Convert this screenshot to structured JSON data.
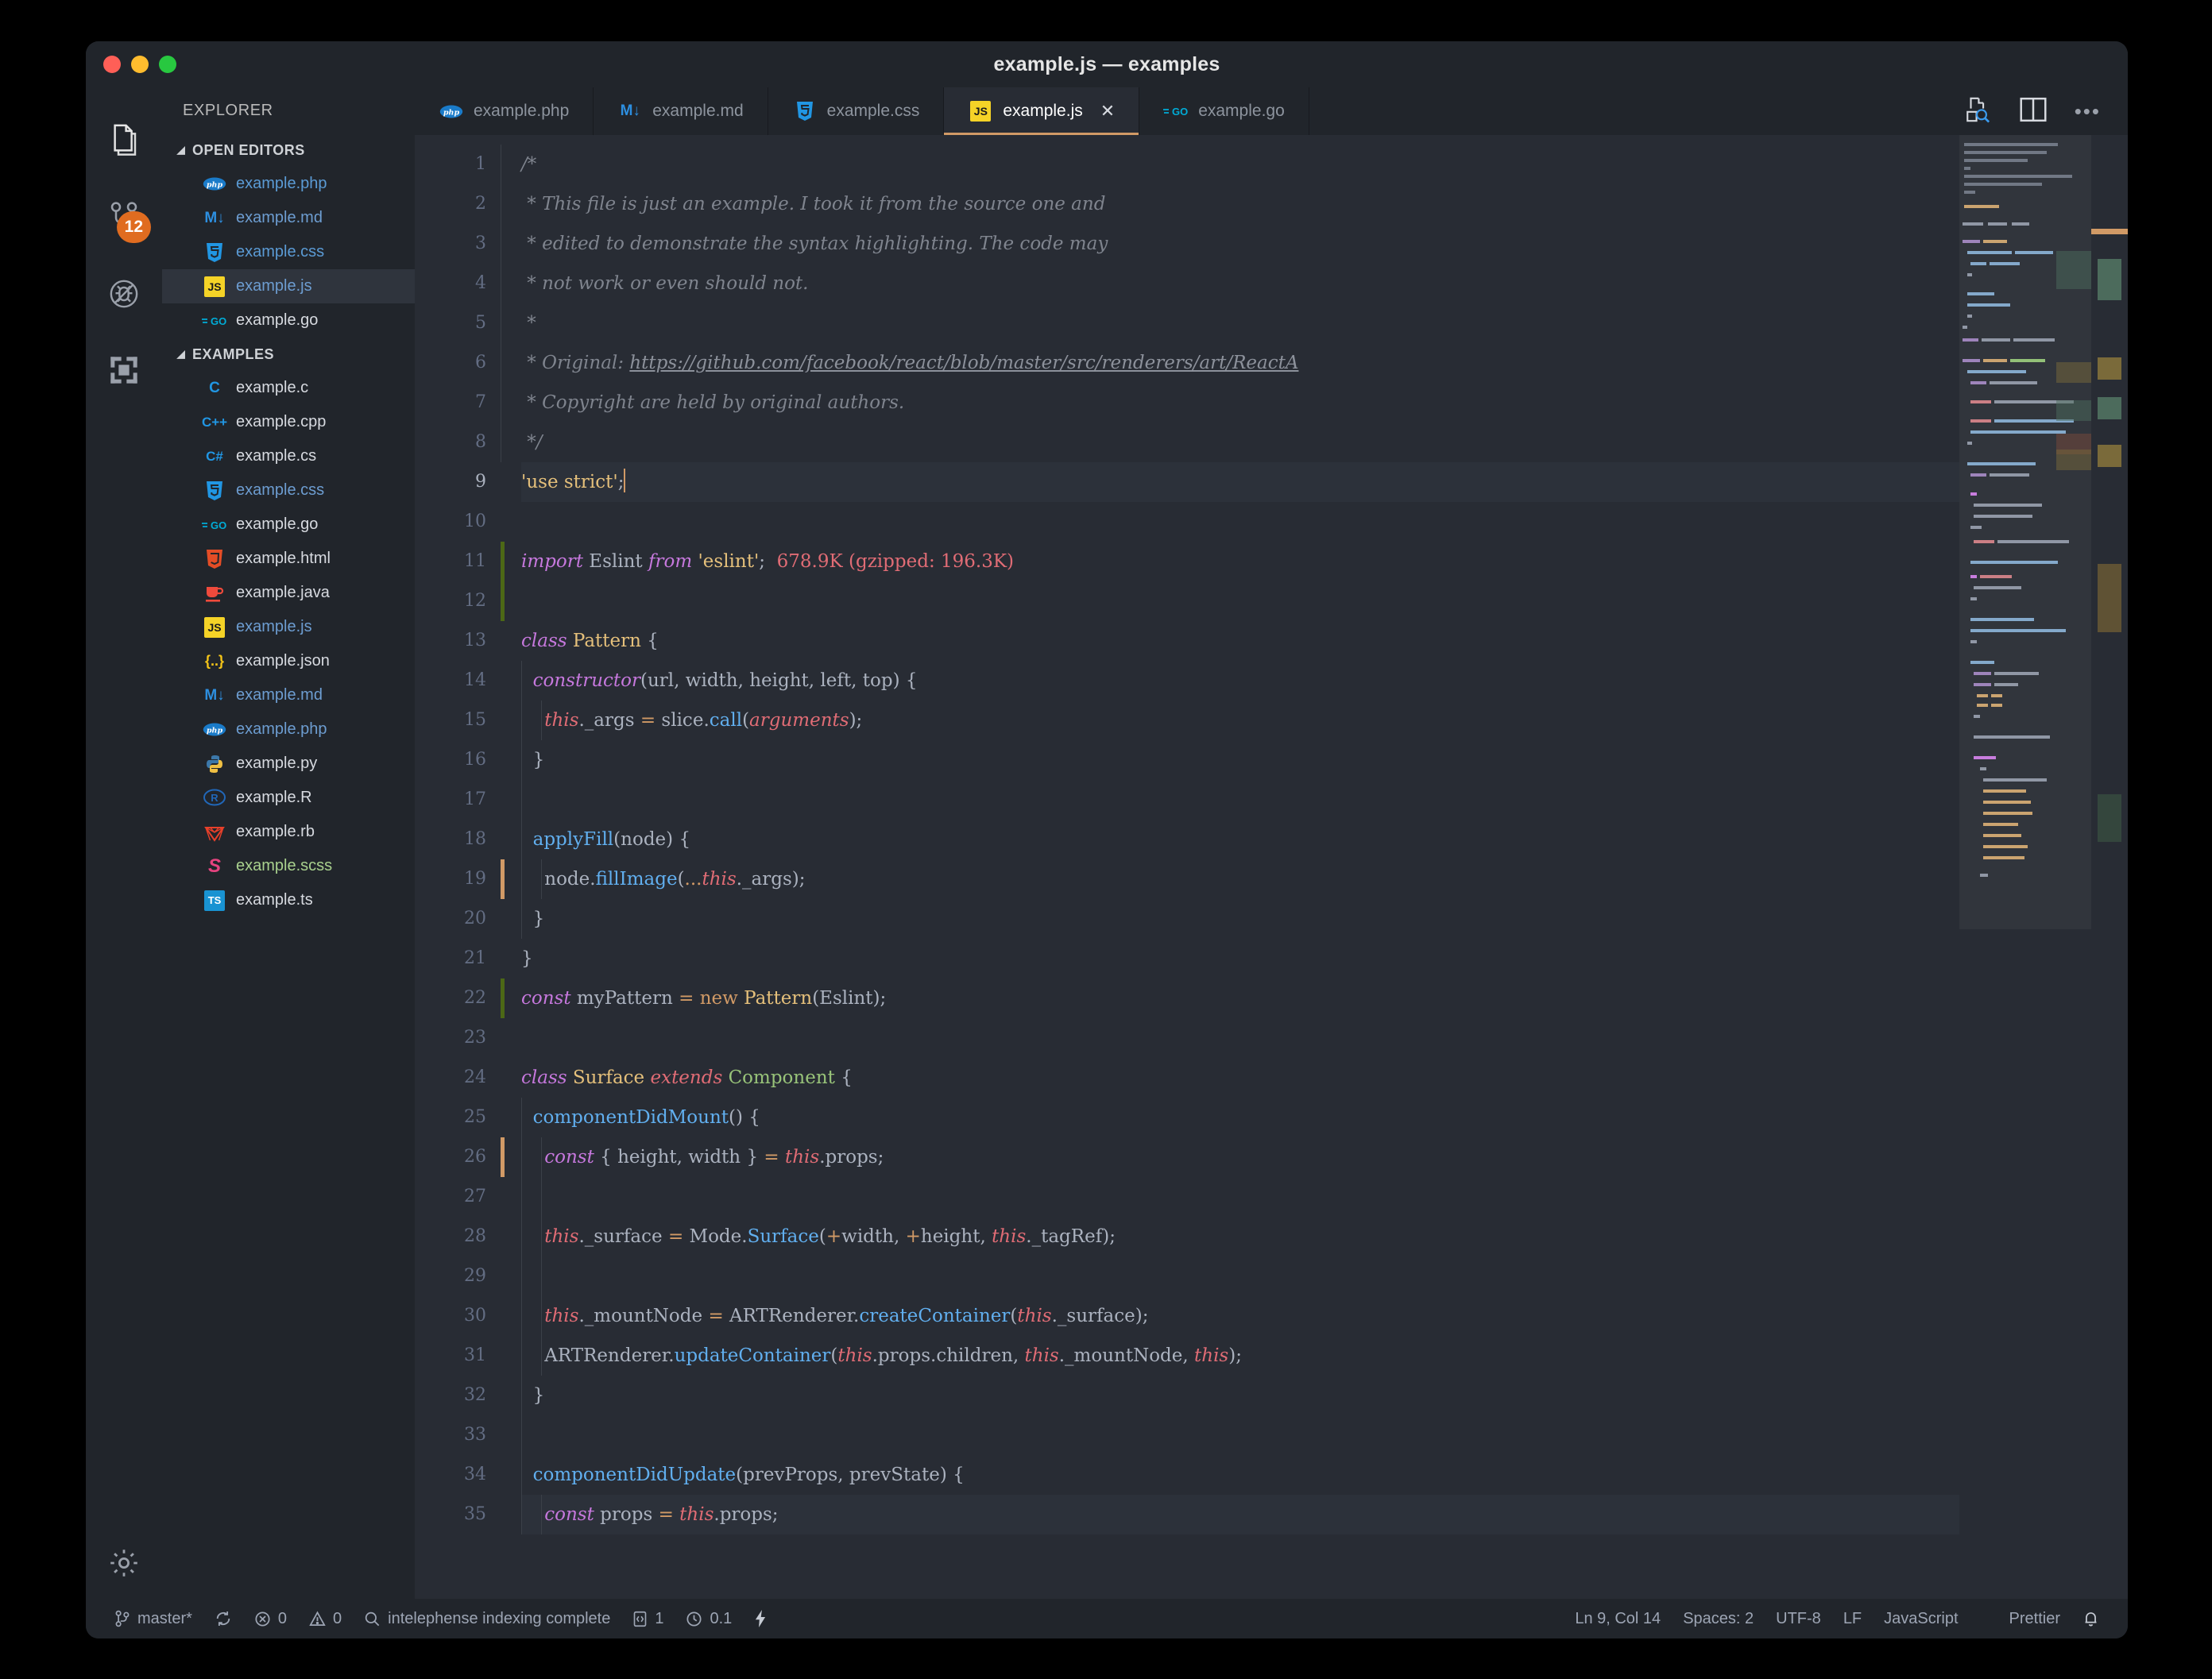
{
  "window": {
    "title": "example.js — examples",
    "traffic_lights": [
      "close",
      "minimize",
      "maximize"
    ]
  },
  "activitybar": {
    "items": [
      {
        "name": "explorer",
        "icon": "files-icon",
        "active": true
      },
      {
        "name": "source-control",
        "icon": "source-control-icon",
        "badge": "12"
      },
      {
        "name": "run-and-debug",
        "icon": "debug-disabled-icon"
      },
      {
        "name": "extensions",
        "icon": "extensions-icon"
      }
    ],
    "settings": {
      "name": "manage",
      "icon": "gear-icon"
    }
  },
  "sidebar": {
    "title": "EXPLORER",
    "sections": [
      {
        "label": "OPEN EDITORS",
        "expanded": true,
        "items": [
          {
            "name": "example.php",
            "icon": "php-icon",
            "color": "#5089c0",
            "selected": false
          },
          {
            "name": "example.md",
            "icon": "markdown-icon",
            "color": "#6d9dd1",
            "selected": false
          },
          {
            "name": "example.css",
            "icon": "css-icon",
            "color": "#5b9bd5",
            "selected": false
          },
          {
            "name": "example.js",
            "icon": "javascript-icon",
            "color": "#6d9dd1",
            "selected": true
          },
          {
            "name": "example.go",
            "icon": "go-icon",
            "color": "#d7dae0",
            "selected": false
          }
        ]
      },
      {
        "label": "EXAMPLES",
        "expanded": true,
        "items": [
          {
            "name": "example.c",
            "icon": "c-icon",
            "color": "#d7dae0"
          },
          {
            "name": "example.cpp",
            "icon": "cpp-icon",
            "color": "#d7dae0"
          },
          {
            "name": "example.cs",
            "icon": "csharp-icon",
            "color": "#d7dae0"
          },
          {
            "name": "example.css",
            "icon": "css-icon",
            "color": "#6d9dd1"
          },
          {
            "name": "example.go",
            "icon": "go-icon",
            "color": "#d7dae0"
          },
          {
            "name": "example.html",
            "icon": "html-icon",
            "color": "#d7dae0"
          },
          {
            "name": "example.java",
            "icon": "java-icon",
            "color": "#d7dae0"
          },
          {
            "name": "example.js",
            "icon": "javascript-icon",
            "color": "#6d9dd1"
          },
          {
            "name": "example.json",
            "icon": "json-icon",
            "color": "#d7dae0"
          },
          {
            "name": "example.md",
            "icon": "markdown-icon",
            "color": "#6d9dd1"
          },
          {
            "name": "example.php",
            "icon": "php-icon",
            "color": "#6d9dd1"
          },
          {
            "name": "example.py",
            "icon": "python-icon",
            "color": "#d7dae0"
          },
          {
            "name": "example.R",
            "icon": "r-icon",
            "color": "#d7dae0"
          },
          {
            "name": "example.rb",
            "icon": "ruby-icon",
            "color": "#d7dae0"
          },
          {
            "name": "example.scss",
            "icon": "sass-icon",
            "color": "#a9d18e"
          },
          {
            "name": "example.ts",
            "icon": "typescript-icon",
            "color": "#d7dae0"
          }
        ]
      }
    ]
  },
  "tabs": {
    "items": [
      {
        "label": "example.php",
        "icon": "php-icon",
        "active": false,
        "closable": false
      },
      {
        "label": "example.md",
        "icon": "markdown-icon",
        "active": false,
        "closable": false
      },
      {
        "label": "example.css",
        "icon": "css-icon",
        "active": false,
        "closable": false
      },
      {
        "label": "example.js",
        "icon": "javascript-icon",
        "active": true,
        "closable": true,
        "close_glyph": "✕"
      },
      {
        "label": "example.go",
        "icon": "go-icon",
        "active": false,
        "closable": false
      }
    ],
    "actions": [
      {
        "name": "open-changes",
        "icon": "open-changes-icon"
      },
      {
        "name": "split-editor",
        "icon": "split-editor-icon"
      },
      {
        "name": "more-actions",
        "icon": "ellipsis-icon",
        "glyph": "•••"
      }
    ]
  },
  "editor": {
    "language": "JavaScript",
    "active_line": 9,
    "lines": [
      {
        "n": 1,
        "indent": 0
      },
      {
        "n": 2,
        "indent": 0
      },
      {
        "n": 3,
        "indent": 0
      },
      {
        "n": 4,
        "indent": 0
      },
      {
        "n": 5,
        "indent": 0
      },
      {
        "n": 6,
        "indent": 0
      },
      {
        "n": 7,
        "indent": 0
      },
      {
        "n": 8,
        "indent": 0
      },
      {
        "n": 9,
        "indent": 0
      },
      {
        "n": 10,
        "indent": 0
      },
      {
        "n": 11,
        "indent": 0
      },
      {
        "n": 12,
        "indent": 0
      },
      {
        "n": 13,
        "indent": 0
      },
      {
        "n": 14,
        "indent": 0
      },
      {
        "n": 15,
        "indent": 0
      },
      {
        "n": 16,
        "indent": 0
      },
      {
        "n": 17,
        "indent": 0
      },
      {
        "n": 18,
        "indent": 0
      },
      {
        "n": 19,
        "indent": 0
      },
      {
        "n": 20,
        "indent": 0
      },
      {
        "n": 21,
        "indent": 0
      },
      {
        "n": 22,
        "indent": 0
      },
      {
        "n": 23,
        "indent": 0
      },
      {
        "n": 24,
        "indent": 0
      },
      {
        "n": 25,
        "indent": 0
      },
      {
        "n": 26,
        "indent": 0
      },
      {
        "n": 27,
        "indent": 0
      },
      {
        "n": 28,
        "indent": 0
      },
      {
        "n": 29,
        "indent": 0
      },
      {
        "n": 30,
        "indent": 0
      },
      {
        "n": 31,
        "indent": 0
      },
      {
        "n": 32,
        "indent": 0
      },
      {
        "n": 33,
        "indent": 0
      },
      {
        "n": 34,
        "indent": 0
      },
      {
        "n": 35,
        "indent": 0
      }
    ],
    "code_text": [
      "/*",
      " * This file is just an example. I took it from the source one and",
      " * edited to demonstrate the syntax highlighting. The code may",
      " * not work or even should not.",
      " *",
      " * Original: https://github.com/facebook/react/blob/master/src/renderers/art/ReactA",
      " * Copyright are held by original authors.",
      " */",
      "'use strict';",
      "",
      "import Eslint from 'eslint';  678.9K (gzipped: 196.3K)",
      "",
      "class Pattern {",
      "  constructor(url, width, height, left, top) {",
      "    this._args = slice.call(arguments);",
      "  }",
      "",
      "  applyFill(node) {",
      "    node.fillImage(...this._args);",
      "  }",
      "}",
      "const myPattern = new Pattern(Eslint);",
      "",
      "class Surface extends Component {",
      "  componentDidMount() {",
      "    const { height, width } = this.props;",
      "",
      "    this._surface = Mode.Surface(+width, +height, this._tagRef);",
      "",
      "    this._mountNode = ARTRenderer.createContainer(this._surface);",
      "    ARTRenderer.updateContainer(this.props.children, this._mountNode, this);",
      "  }",
      "",
      "  componentDidUpdate(prevProps, prevState) {",
      "    const props = this.props;"
    ],
    "inline_hint": "678.9K (gzipped: 196.3K)",
    "fold_lines": [
      13,
      14,
      18,
      24,
      25,
      34
    ],
    "breakpoint_hint_line": 9
  },
  "statusbar": {
    "left": [
      {
        "name": "branch",
        "icon": "source-control-icon",
        "text": "master*"
      },
      {
        "name": "sync",
        "icon": "sync-icon",
        "text": ""
      },
      {
        "name": "errors",
        "icon": "error-icon",
        "text": "0"
      },
      {
        "name": "warnings",
        "icon": "warning-icon",
        "text": "0"
      },
      {
        "name": "intelephense",
        "icon": "search-icon",
        "text": "intelephense indexing complete"
      },
      {
        "name": "ports",
        "icon": "code-icon",
        "text": "1"
      },
      {
        "name": "timer",
        "icon": "clock-icon",
        "text": "0.1"
      },
      {
        "name": "lightning",
        "icon": "bolt-icon",
        "text": ""
      }
    ],
    "right": [
      {
        "name": "cursor-position",
        "text": "Ln 9, Col 14"
      },
      {
        "name": "indentation",
        "text": "Spaces: 2"
      },
      {
        "name": "encoding",
        "text": "UTF-8"
      },
      {
        "name": "eol",
        "text": "LF"
      },
      {
        "name": "language-mode",
        "text": "JavaScript"
      },
      {
        "name": "formatter",
        "text": "Prettier"
      },
      {
        "name": "notifications",
        "icon": "bell-icon",
        "text": ""
      }
    ]
  },
  "colors": {
    "editor_bg": "#282c34",
    "chrome_bg": "#21252b",
    "accent": "#d19a66",
    "badge": "#e06c20",
    "selection": "#2f343d",
    "line_highlight": "#2c313a"
  }
}
